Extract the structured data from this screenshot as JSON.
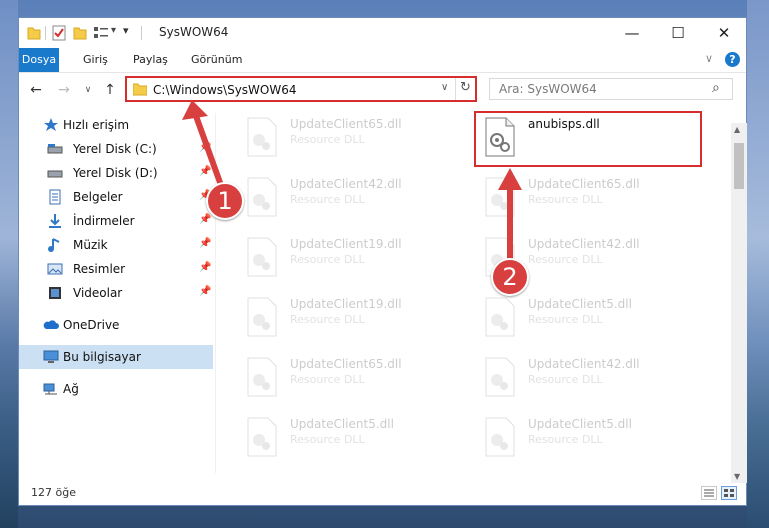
{
  "window": {
    "title": "SysWOW64",
    "qa_dropdown": "▾",
    "controls": {
      "minimize": "—",
      "maximize": "☐",
      "close": "✕"
    }
  },
  "ribbon": {
    "tabs": [
      {
        "label": "Dosya",
        "active": true
      },
      {
        "label": "Giriş"
      },
      {
        "label": "Paylaş"
      },
      {
        "label": "Görünüm"
      }
    ],
    "expand": "∨",
    "help": "?"
  },
  "navigation": {
    "back": "←",
    "forward": "→",
    "recent": "∨",
    "up": "↑",
    "address": "C:\\Windows\\SysWOW64",
    "address_dropdown": "∨",
    "refresh": "↻",
    "search_placeholder": "Ara: SysWOW64",
    "search_icon": "⌕"
  },
  "sidebar": {
    "items": [
      {
        "label": "Hızlı erişim",
        "icon": "star-icon"
      },
      {
        "label": "Yerel Disk (C:)",
        "icon": "drive-icon",
        "pinned": true
      },
      {
        "label": "Yerel Disk (D:)",
        "icon": "drive-icon",
        "pinned": true
      },
      {
        "label": "Belgeler",
        "icon": "documents-icon",
        "pinned": true
      },
      {
        "label": "İndirmeler",
        "icon": "downloads-icon",
        "pinned": true
      },
      {
        "label": "Müzik",
        "icon": "music-icon",
        "pinned": true
      },
      {
        "label": "Resimler",
        "icon": "pictures-icon",
        "pinned": true
      },
      {
        "label": "Videolar",
        "icon": "videos-icon",
        "pinned": true
      },
      {
        "label": "OneDrive",
        "icon": "cloud-icon"
      },
      {
        "label": "Bu bilgisayar",
        "icon": "computer-icon",
        "selected": true
      },
      {
        "label": "Ağ",
        "icon": "network-icon"
      }
    ],
    "pin_glyph": "📌"
  },
  "files": {
    "left_column": [
      {
        "name": "UpdateClient65.dll",
        "type": "Resource DLL"
      },
      {
        "name": "UpdateClient42.dll",
        "type": "Resource DLL"
      },
      {
        "name": "UpdateClient19.dll",
        "type": "Resource DLL"
      },
      {
        "name": "UpdateClient19.dll",
        "type": "Resource DLL"
      },
      {
        "name": "UpdateClient65.dll",
        "type": "Resource DLL"
      },
      {
        "name": "UpdateClient5.dll",
        "type": "Resource DLL"
      }
    ],
    "right_column": [
      {
        "name": "anubisps.dll",
        "type": "",
        "highlighted": true
      },
      {
        "name": "UpdateClient65.dll",
        "type": "Resource DLL"
      },
      {
        "name": "UpdateClient42.dll",
        "type": "Resource DLL"
      },
      {
        "name": "UpdateClient5.dll",
        "type": "Resource DLL"
      },
      {
        "name": "UpdateClient42.dll",
        "type": "Resource DLL"
      },
      {
        "name": "UpdateClient5.dll",
        "type": "Resource DLL"
      }
    ]
  },
  "status": {
    "item_count": "127 öğe"
  },
  "annotations": [
    {
      "number": "1",
      "target": "address-bar"
    },
    {
      "number": "2",
      "target": "anubisps.dll"
    }
  ],
  "colors": {
    "accent": "#1979ca",
    "highlight": "#d62d2d",
    "selected": "#cce0f4"
  }
}
